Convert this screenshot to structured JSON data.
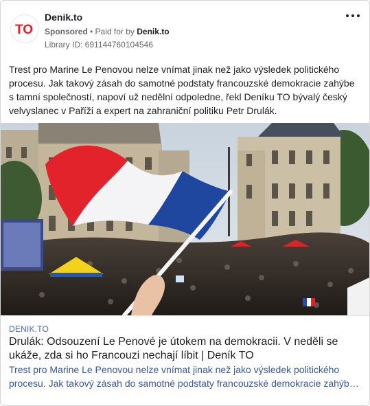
{
  "ad": {
    "page_name": "Denik.to",
    "sponsored": "Sponsored",
    "paid_for_by": "• Paid for by",
    "payer": "Denik.to",
    "library_id": "Library ID: 691144760104546",
    "logo_text": "TO",
    "more_icon": "more-horizontal-icon"
  },
  "body": {
    "text": "Trest pro Marine Le Penovou nelze vnímat jinak než jako výsledek politického procesu. Jak takový zásah do samotné podstaty francouzské demokracie zahýbe s tamní společností, napoví už nedělní odpoledne, řekl Deníku TO bývalý český velvyslanec v Paříži a expert na zahraniční politiku Petr Drulák."
  },
  "link": {
    "domain": "DENIK.TO",
    "headline": "Drulák: Odsouzení Le Penové je útokem na demokracii. V neděli se ukáže, zda si ho Francouzi nechají líbit | Deník TO",
    "desc_line1": "Trest pro Marine Le Penovou nelze vnímat jinak než jako výsledek politického",
    "desc_line2": "procesu. Jak takový zásah do samotné podstaty francouzské demokracie zahýb…"
  },
  "colors": {
    "brand_red": "#e3222b",
    "link_blue": "#385898",
    "domain_blue": "#4b6bb3"
  }
}
